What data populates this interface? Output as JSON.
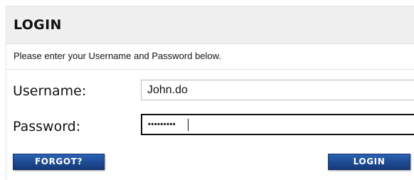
{
  "header": {
    "title": "LOGIN"
  },
  "instructions": "Please enter your Username and Password below.",
  "form": {
    "username_label": "Username:",
    "username_value": "John.do",
    "password_label": "Password:",
    "password_value": "•••••••••"
  },
  "buttons": {
    "forgot_label": "FORGOT?",
    "login_label": "LOGIN"
  },
  "colors": {
    "button_blue": "#1e4a92",
    "header_bg": "#f0f0f0"
  }
}
